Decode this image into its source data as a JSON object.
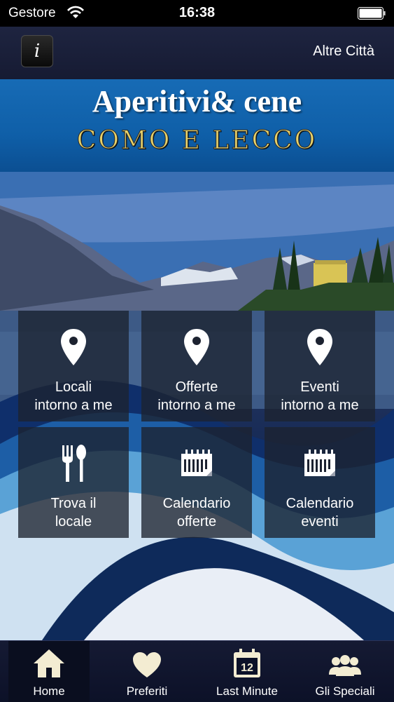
{
  "status_bar": {
    "carrier": "Gestore",
    "time": "16:38"
  },
  "nav": {
    "info_button": "i",
    "altre_citta": "Altre Città"
  },
  "banner": {
    "title": "Aperitivi& cene",
    "subtitle": "COMO E LECCO"
  },
  "tiles": [
    {
      "line1": "Locali",
      "line2": "intorno a me",
      "icon": "location-pin-icon"
    },
    {
      "line1": "Offerte",
      "line2": "intorno a me",
      "icon": "location-pin-icon"
    },
    {
      "line1": "Eventi",
      "line2": "intorno a me",
      "icon": "location-pin-icon"
    },
    {
      "line1": "Trova il",
      "line2": "locale",
      "icon": "fork-spoon-icon"
    },
    {
      "line1": "Calendario",
      "line2": "offerte",
      "icon": "calendar-icon"
    },
    {
      "line1": "Calendario",
      "line2": "eventi",
      "icon": "calendar-icon"
    }
  ],
  "tab_bar": {
    "items": [
      {
        "label": "Home",
        "icon": "home-icon",
        "active": true
      },
      {
        "label": "Preferiti",
        "icon": "heart-icon",
        "active": false
      },
      {
        "label": "Last Minute",
        "icon": "calendar-12-icon",
        "calendar_day": "12",
        "active": false
      },
      {
        "label": "Gli Speciali",
        "icon": "group-icon",
        "active": false
      }
    ]
  },
  "colors": {
    "banner_blue": "#0f5fa8",
    "subtitle_gold": "#e9d36a",
    "tile_bg": "#1c2230",
    "nav_bg": "#1e2440"
  }
}
